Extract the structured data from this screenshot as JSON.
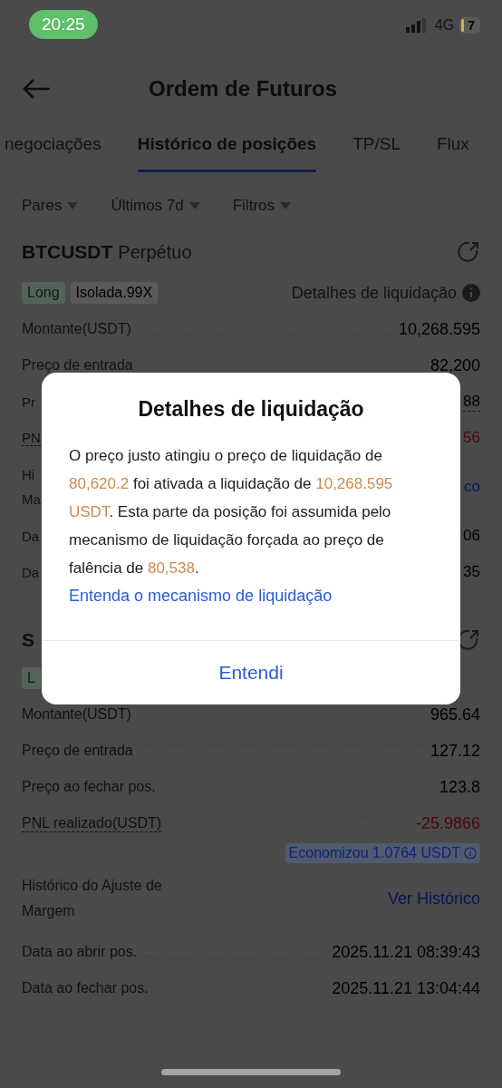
{
  "status_bar": {
    "time": "20:25",
    "network": "4G",
    "battery": "7"
  },
  "header": {
    "title": "Ordem de Futuros"
  },
  "tabs": [
    {
      "label": "negociações",
      "selected": false
    },
    {
      "label": "Histórico de posições",
      "selected": true
    },
    {
      "label": "TP/SL",
      "selected": false
    },
    {
      "label": "Flux",
      "selected": false
    }
  ],
  "filters": [
    {
      "label": "Pares"
    },
    {
      "label": "Últimos 7d"
    },
    {
      "label": "Filtros"
    }
  ],
  "positions": [
    {
      "symbol": "BTCUSDT",
      "type": "Perpétuo",
      "tags": [
        {
          "label": "Long",
          "kind": "side"
        },
        {
          "label": "Isolada.99X",
          "kind": "margin"
        }
      ],
      "liquidation_details": "Detalhes de liquidação",
      "rows": [
        {
          "label": "Montante(USDT)",
          "value": "10,268.595",
          "kind": "plain"
        },
        {
          "label": "Preço de entrada",
          "value": "82,200",
          "kind": "plain"
        },
        {
          "label": "Pr",
          "value": "88",
          "kind": "plain",
          "covered": true,
          "value_dotted": true
        },
        {
          "label": "PN",
          "value": "56",
          "kind": "loss",
          "covered": true,
          "label_dotted": true
        },
        {
          "label": "Hi",
          "label_2": "Ma",
          "value": "co",
          "kind": "link",
          "covered": true
        },
        {
          "label": "Da",
          "value": "06",
          "kind": "plain",
          "covered": true
        },
        {
          "label": "Da",
          "value": "35",
          "kind": "plain",
          "covered": true
        }
      ]
    },
    {
      "symbol": "S",
      "tags": [
        {
          "label": "L",
          "kind": "side"
        }
      ],
      "rows": [
        {
          "label": "Montante(USDT)",
          "value": "965.64",
          "kind": "plain"
        },
        {
          "label": "Preço de entrada",
          "value": "127.12",
          "kind": "plain"
        },
        {
          "label": "Preço ao fechar pos.",
          "value": "123.8",
          "kind": "plain"
        },
        {
          "label": "PNL realizado(USDT)",
          "value": "-25.9866",
          "kind": "loss",
          "label_dotted": true,
          "note": "Economizou 1.0764 USDT"
        },
        {
          "label": "Histórico do Ajuste de Margem",
          "value": "Ver Histórico",
          "kind": "link"
        },
        {
          "label": "Data ao abrir pos.",
          "value": "2025.11.21 08:39:43",
          "kind": "plain"
        },
        {
          "label": "Data ao fechar pos.",
          "value": "2025.11.21 13:04:44",
          "kind": "plain"
        }
      ]
    }
  ],
  "dialog": {
    "title": "Detalhes de liquidação",
    "message": [
      {
        "text": "O preço justo atingiu o preço de liquidação de ",
        "kind": "plain"
      },
      {
        "text": "80,620.2",
        "kind": "amount"
      },
      {
        "text": " foi ativada a liquidação de ",
        "kind": "plain"
      },
      {
        "text": "10,268.595 USDT",
        "kind": "amount"
      },
      {
        "text": ". Esta parte da posição foi assumida pelo mecanismo de liquidação forçada ao preço de falência de ",
        "kind": "plain"
      },
      {
        "text": "80,538",
        "kind": "amount"
      },
      {
        "text": ".",
        "kind": "plain"
      }
    ],
    "link": "Entenda o mecanismo de liquidação",
    "button": "Entendi"
  }
}
